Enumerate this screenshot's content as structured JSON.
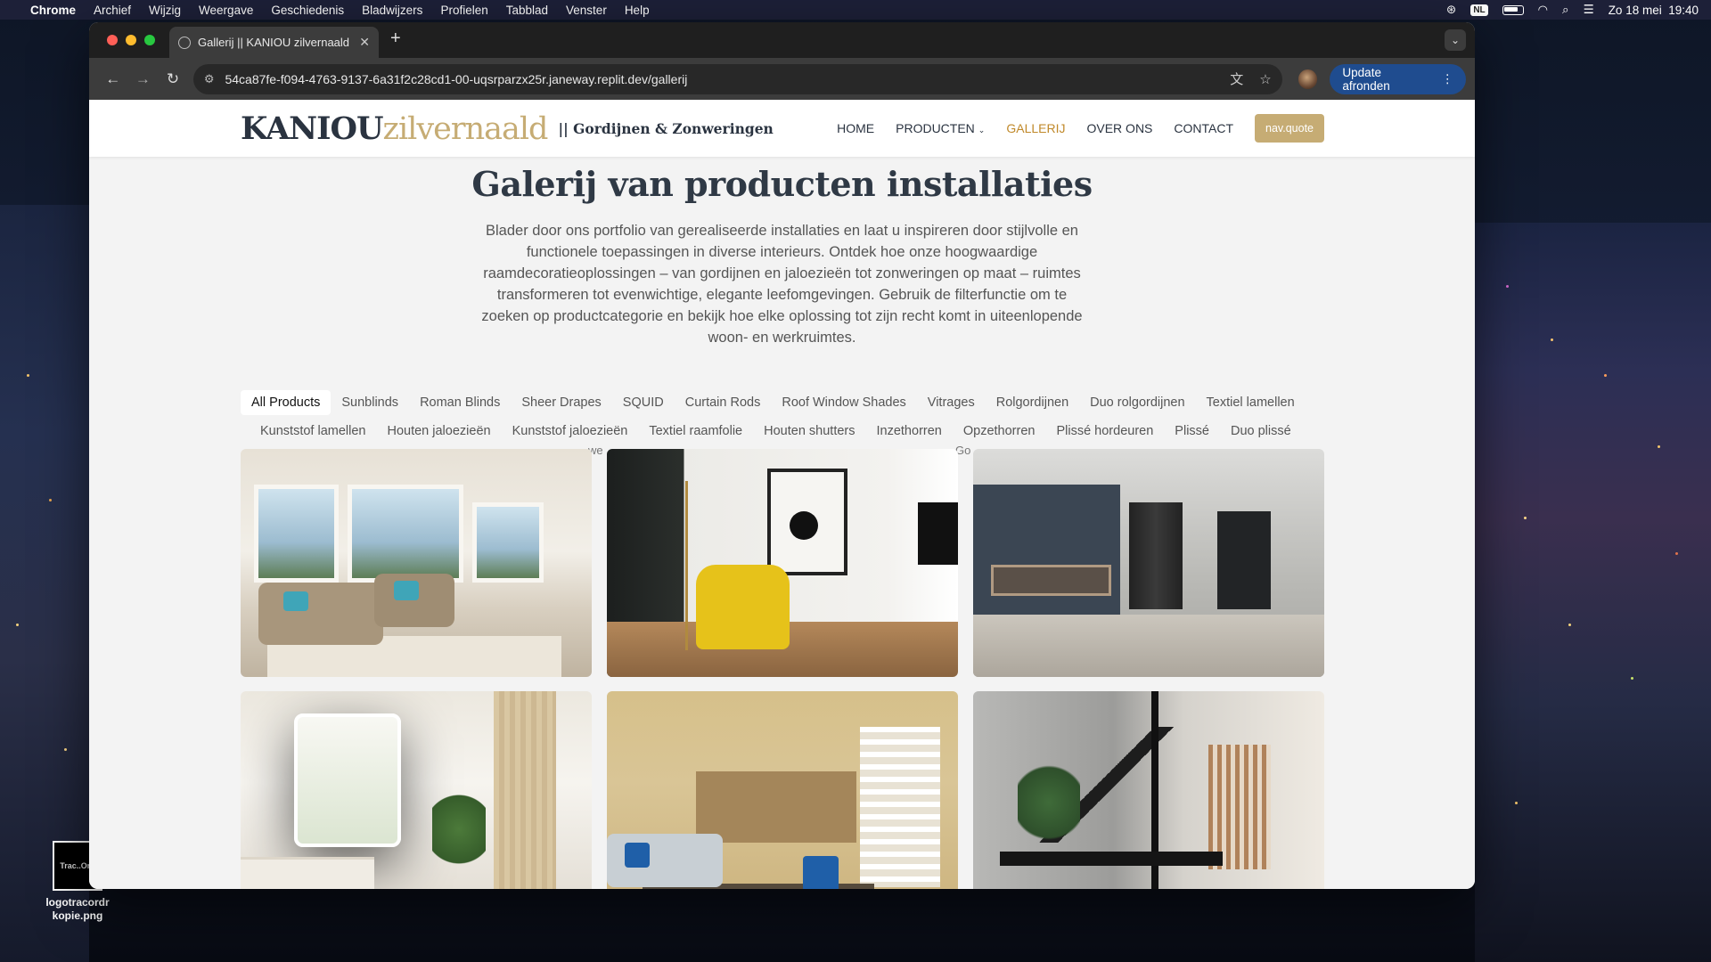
{
  "menubar": {
    "app": "Chrome",
    "items": [
      "Archief",
      "Wijzig",
      "Weergave",
      "Geschiedenis",
      "Bladwijzers",
      "Profielen",
      "Tabblad",
      "Venster",
      "Help"
    ],
    "input_source": "NL",
    "clock": "Zo 18 mei  19:40"
  },
  "desktop": {
    "file_label": "logotracordr kopie.png",
    "thumb_text": "Trac..Ord"
  },
  "browser": {
    "tab_title": "Gallerij || KANIOU zilvernaald",
    "url": "54ca87fe-f094-4763-9137-6a31f2c28cd1-00-uqsrparzx25r.janeway.replit.dev/gallerij",
    "update_label": "Update afronden"
  },
  "site": {
    "logo_main": "KANIOU",
    "logo_accent": "zilvernaald",
    "tagline": "|| Gordijnen & Zonweringen",
    "nav": {
      "home": "HOME",
      "products": "PRODUCTEN",
      "gallery": "GALLERIJ",
      "about": "OVER ONS",
      "contact": "CONTACT",
      "quote": "nav.quote"
    },
    "accent_color": "#c6ac74",
    "active_color": "#c0892a",
    "heading": "Galerij van producten installaties",
    "intro": "Blader door ons portfolio van gerealiseerde installaties en laat u inspireren door stijlvolle en functionele toepassingen in diverse interieurs. Ontdek hoe onze hoogwaardige raamdecoratieoplossingen – van gordijnen en jaloezieën tot zonweringen op maat – ruimtes transformeren tot evenwichtige, elegante leefomgevingen. Gebruik de filterfunctie om te zoeken op productcategorie en bekijk hoe elke oplossing tot zijn recht komt in uiteenlopende woon- en werkruimtes.",
    "filters_row1": [
      "All Products",
      "Sunblinds",
      "Roman Blinds",
      "Sheer Drapes",
      "SQUID",
      "Curtain Rods",
      "Roof Window Shades",
      "Vitrages",
      "Rolgordijnen",
      "Duo rolgordijnen",
      "Textiel lamellen"
    ],
    "filters_row2": [
      "Kunststof lamellen",
      "Houten jaloezieën",
      "Kunststof jaloezieën",
      "Textiel raamfolie",
      "Houten shutters",
      "Inzethorren",
      "Opzethorren",
      "Plissé hordeuren",
      "Plissé",
      "Duo plissé"
    ],
    "peek_left": "we",
    "peek_right": "Go"
  }
}
